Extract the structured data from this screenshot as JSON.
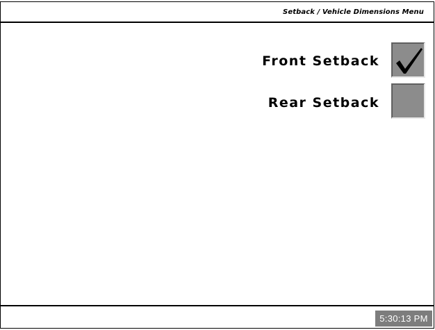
{
  "header": {
    "menu_title": "Setback / Vehicle Dimensions Menu"
  },
  "options": [
    {
      "label": "Front Setback",
      "checked": true
    },
    {
      "label": "Rear Setback",
      "checked": false
    }
  ],
  "status_bar": {
    "clock": "5:30:13 PM"
  },
  "colors": {
    "checkbox_fill": "#8c8c8c",
    "clock_background": "#7d7d7d",
    "check_mark": "#000000"
  },
  "icons": {
    "check": "check-icon"
  }
}
